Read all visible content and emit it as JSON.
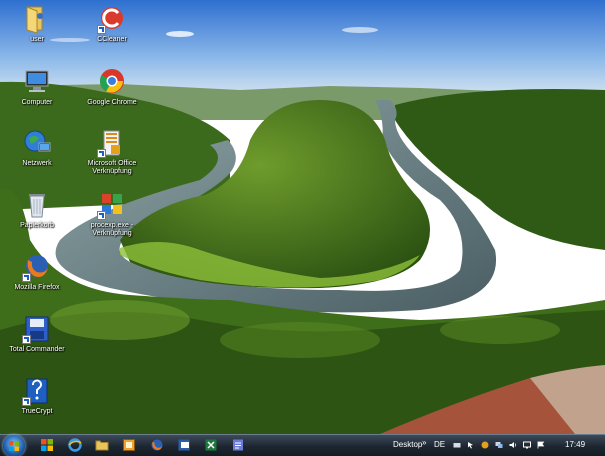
{
  "desktop_icons": [
    {
      "name": "user-folder",
      "label": "user"
    },
    {
      "name": "ccleaner",
      "label": "CCleaner"
    },
    {
      "name": "computer",
      "label": "Computer"
    },
    {
      "name": "google-chrome",
      "label": "Google Chrome"
    },
    {
      "name": "network",
      "label": "Netzwerk"
    },
    {
      "name": "microsoft-office",
      "label": "Microsoft Office Verknüpfung"
    },
    {
      "name": "recycle-bin",
      "label": "Papierkorb"
    },
    {
      "name": "procexp",
      "label": "procexp.exe - Verknüpfung"
    },
    {
      "name": "mozilla-firefox",
      "label": "Mozilla Firefox"
    },
    {
      "name": "total-commander",
      "label": "Total Commander"
    },
    {
      "name": "truecrypt",
      "label": "TrueCrypt"
    }
  ],
  "taskbar": {
    "pinned_icons": [
      "windows-explorer-icon",
      "internet-explorer-icon",
      "folder-icon",
      "app-icon",
      "firefox-icon",
      "word-icon",
      "excel-icon",
      "document-icon"
    ],
    "desktop_toolbar_label": "Desktop",
    "toolbar_chevron": "»",
    "language": "DE",
    "clock": "17:49",
    "tray_icons": [
      "keyboard-icon",
      "cursor-icon",
      "security-icon",
      "network-icon",
      "volume-icon",
      "display-icon",
      "flag-icon"
    ]
  },
  "colors": {
    "taskbar": "#1d2630",
    "label_text": "#ffffff"
  }
}
